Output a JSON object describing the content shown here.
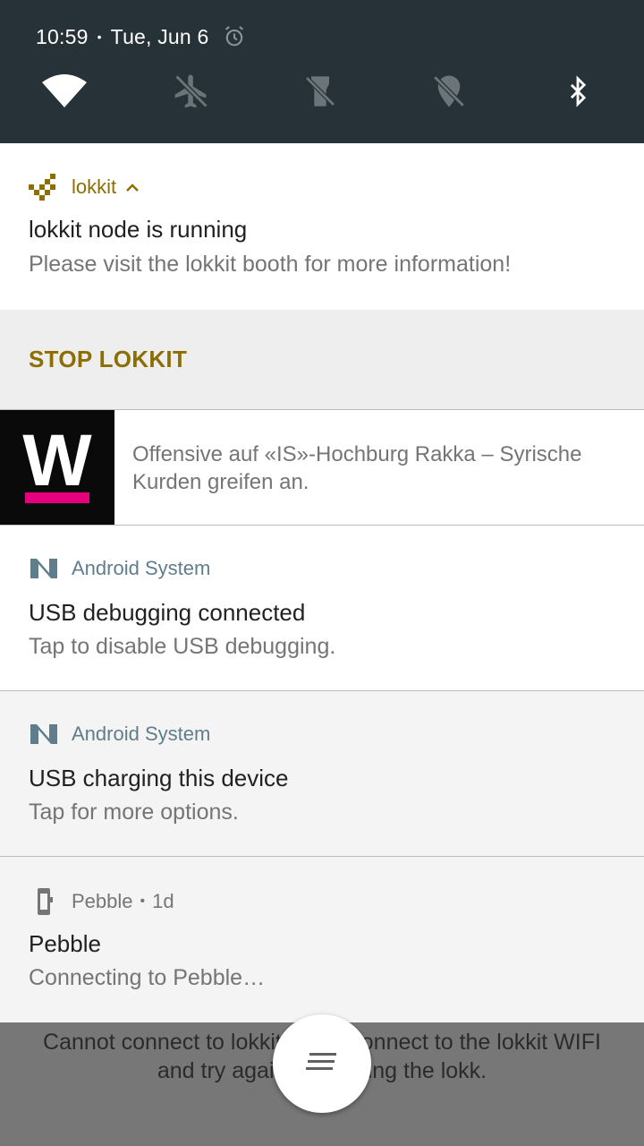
{
  "status": {
    "time": "10:59",
    "separator": "•",
    "date": "Tue, Jun 6"
  },
  "quick_settings": {
    "tiles": [
      "wifi-icon",
      "airplane-mode-off-icon",
      "flashlight-off-icon",
      "location-off-icon",
      "bluetooth-icon"
    ]
  },
  "notifications": {
    "lokkit": {
      "app": "lokkit",
      "title": "lokkit node is running",
      "body": "Please visit the lokkit booth for more information!",
      "action": "STOP LOKKIT",
      "accent": "#8d6e00"
    },
    "news": {
      "body": "Offensive auf «IS»-Hochburg Rakka – Syrische Kurden greifen an.",
      "logo_letter": "W",
      "logo_accent": "#e6007e"
    },
    "usb_debug": {
      "app": "Android System",
      "title": "USB debugging connected",
      "body": "Tap to disable USB debugging."
    },
    "usb_charge": {
      "app": "Android System",
      "title": "USB charging this device",
      "body": "Tap for more options."
    },
    "pebble": {
      "app": "Pebble",
      "separator": "•",
      "age": "1d",
      "title": "Pebble",
      "body": "Connecting to Pebble…"
    }
  },
  "background_app": {
    "line1": "Cannot connect to lokkit.          connect to the lokkit WIFI",
    "line2": "and try agai               ing the lokk."
  }
}
